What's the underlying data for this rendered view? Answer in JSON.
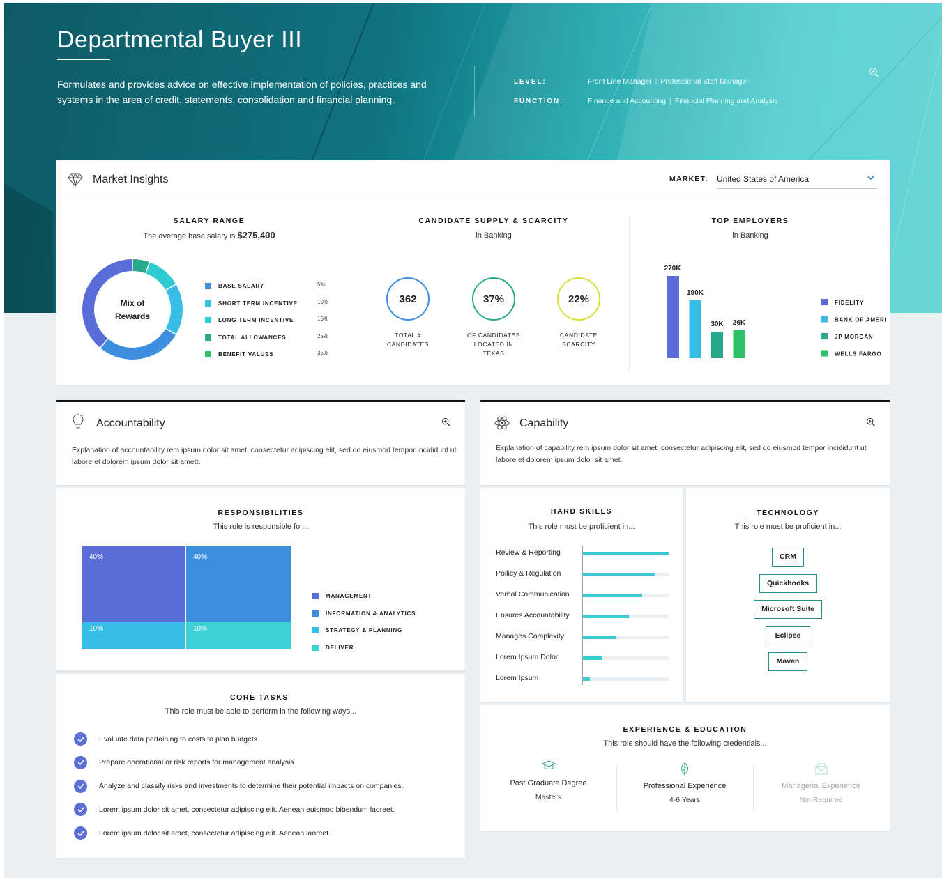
{
  "header": {
    "title": "Departmental Buyer III",
    "description": "Formulates and provides advice on effective implementation of policies, practices and systems in the area of credit, statements, consolidation and financial planning.",
    "level_label": "LEVEL:",
    "level_values": [
      "Front Line Manager",
      "Professional Staff Manager"
    ],
    "function_label": "FUNCTION:",
    "function_values": [
      "Finance and Accounting",
      "Financial Planning and Analysis"
    ],
    "separator": "|",
    "zoom_icon": "zoom-in-icon"
  },
  "market_insights": {
    "title": "Market Insights",
    "icon": "diamond-icon",
    "market_label": "MARKET:",
    "market_value": "United States of America",
    "salary": {
      "title": "SALARY RANGE",
      "subtitle_prefix": "The average base salary is",
      "average": "$275,400",
      "donut_label_1": "Mix of",
      "donut_label_2": "Rewards",
      "legend": [
        {
          "label": "BASE SALARY",
          "pct": "5%",
          "value": 5,
          "color": "#2aa88c"
        },
        {
          "label": "SHORT TERM INCENTIVE",
          "pct": "10%",
          "value": 10,
          "color": "#2fcbd3"
        },
        {
          "label": "LONG TERM INCENTIVE",
          "pct": "15%",
          "value": 15,
          "color": "#37bde6"
        },
        {
          "label": "TOTAL ALLOWANCES",
          "pct": "25%",
          "value": 25,
          "color": "#3e8ee0"
        },
        {
          "label": "BENEFIT VALUES",
          "pct": "35%",
          "value": 35,
          "color": "#5a6cd7"
        }
      ],
      "legend_colors": [
        "#3e8ee0",
        "#37bde6",
        "#2fcbd3",
        "#2aa88c",
        "#2fc06a"
      ]
    },
    "supply": {
      "title": "CANDIDATE SUPPLY & SCARCITY",
      "subtitle": "in Banking",
      "stats": [
        {
          "value": "362",
          "caption": [
            "TOTAL #",
            "CANDIDATES"
          ],
          "color": "#3e8ee0"
        },
        {
          "value": "37%",
          "caption": [
            "OF CANDIDATES",
            "LOCATED IN",
            "TEXAS"
          ],
          "color": "#2aa88c"
        },
        {
          "value": "22%",
          "caption": [
            "CANDIDATE",
            "SCARCITY"
          ],
          "color": "#d9df3a"
        }
      ]
    },
    "employers": {
      "title": "TOP EMPLOYERS",
      "subtitle": "in Banking"
    }
  },
  "accountability": {
    "title": "Accountability",
    "icon": "lightbulb-icon",
    "description": "Explanation of accountability rem ipsum dolor sit amet, consectetur adipiscing elit, sed do eiusmod tempor incididunt ut labore et dolorem ipsum dolor sit amett."
  },
  "capability": {
    "title": "Capability",
    "icon": "atom-icon",
    "description": "Explanation of capability rem ipsum dolor sit amet, consectetur adipiscing elit, sed do eiusmod tempor incididunt ut labore et dolorem ipsum dolor sit amet."
  },
  "responsibilities": {
    "title": "RESPONSIBILITIES",
    "subtitle": "This role is responsible for...",
    "cells": [
      {
        "label": "40%",
        "value": 40,
        "color": "#5a6cd7"
      },
      {
        "label": "40%",
        "value": 40,
        "color": "#3e8ee0"
      },
      {
        "label": "10%",
        "value": 10,
        "color": "#37bde6"
      },
      {
        "label": "10%",
        "value": 10,
        "color": "#3dd0d4"
      }
    ],
    "legend": [
      {
        "label": "MANAGEMENT",
        "color": "#5a6cd7"
      },
      {
        "label": "INFORMATION & ANALYTICS",
        "color": "#3e8ee0"
      },
      {
        "label": "STRATEGY & PLANNING",
        "color": "#37bde6"
      },
      {
        "label": "DELIVER",
        "color": "#3dd0d4"
      }
    ]
  },
  "core_tasks": {
    "title": "CORE TASKS",
    "subtitle": "This role must be able to perform in the following ways...",
    "items": [
      "Evaluate data pertaining to costs to plan budgets.",
      "Prepare operational or risk reports for management analysis.",
      "Analyze and classify risks and investments to determine their potential impacts on companies.",
      "Lorem ipsum dolor sit amet, consectetur adipiscing elit. Aenean euismod bibendum laoreet.",
      "Lorem ipsum dolor sit amet, consectetur adipiscing elit. Aenean laoreet."
    ]
  },
  "hard_skills": {
    "title": "HARD SKILLS",
    "subtitle": "This role must be proficient in...",
    "items": [
      {
        "label": "Review & Reporting",
        "level": 1.0
      },
      {
        "label": "Poilicy & Regulation",
        "level": 0.84
      },
      {
        "label": "Verbal Communication",
        "level": 0.69
      },
      {
        "label": "Ensures Accountability",
        "level": 0.54
      },
      {
        "label": "Manages Complexity",
        "level": 0.38
      },
      {
        "label": "Lorem Ipsum Dolor",
        "level": 0.23
      },
      {
        "label": "Lorem Ipsum",
        "level": 0.08
      }
    ]
  },
  "technology": {
    "title": "TECHNOLOGY",
    "subtitle": "This role must be proficient in...",
    "items": [
      "CRM",
      "Quickbooks",
      "Microsoft Suite",
      "Eclipse",
      "Maven"
    ]
  },
  "experience": {
    "title": "EXPERIENCE & EDUCATION",
    "subtitle": "This role should have the following credentials...",
    "items": [
      {
        "title": "Post Graduate Degree",
        "value": "Masters",
        "icon": "graduation-cap-icon",
        "color": "#2aa88c"
      },
      {
        "title": "Professional Experience",
        "value": "4-6 Years",
        "icon": "leaf-icon",
        "color": "#2aa88c"
      },
      {
        "title": "Managerial Experience",
        "value": "Not Required",
        "icon": "envelope-icon",
        "color": "#9ee0cf"
      }
    ]
  },
  "chart_data": [
    {
      "type": "pie",
      "title": "Mix of Rewards",
      "categories": [
        "BASE SALARY",
        "SHORT TERM INCENTIVE",
        "LONG TERM INCENTIVE",
        "TOTAL ALLOWANCES",
        "BENEFIT VALUES"
      ],
      "values": [
        5,
        10,
        15,
        25,
        35
      ]
    },
    {
      "type": "bar",
      "title": "TOP EMPLOYERS",
      "categories": [
        "FIDELITY",
        "BANK OF AMERICA",
        "JP MORGAN",
        "WELLS FARGO"
      ],
      "values": [
        270000,
        190000,
        30000,
        26000
      ],
      "labels": [
        "270K",
        "190K",
        "30K",
        "26K"
      ],
      "colors": [
        "#5a6cd7",
        "#37bde6",
        "#2aa88c",
        "#2fc06a"
      ],
      "ylim": [
        0,
        270000
      ]
    }
  ]
}
